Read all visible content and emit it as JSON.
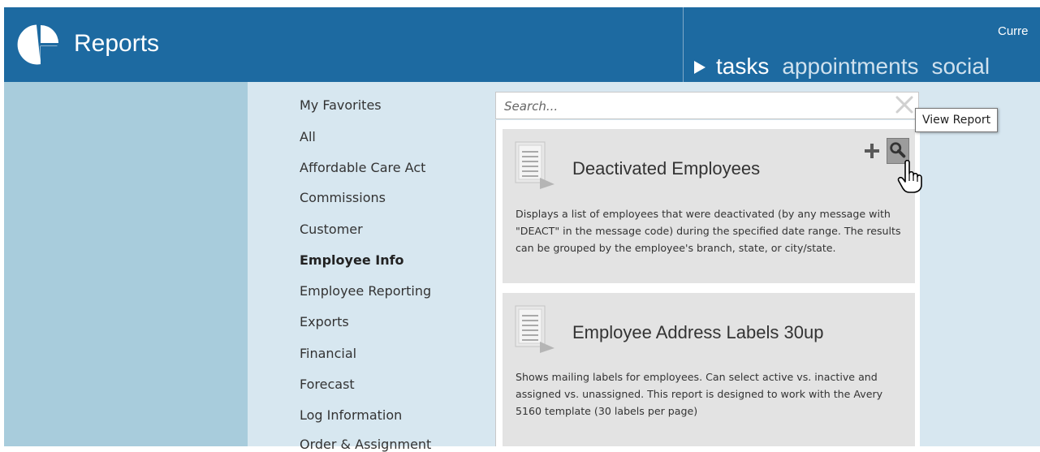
{
  "header": {
    "app_title": "Reports",
    "current_label": "Curre",
    "nav": {
      "arrow": "play-triangle-icon",
      "items": [
        {
          "label": "tasks",
          "active": true
        },
        {
          "label": "appointments",
          "active": false
        },
        {
          "label": "social",
          "active": false
        }
      ]
    },
    "colors": {
      "brand": "#1d6aa1"
    }
  },
  "sidebar": {
    "categories": [
      {
        "label": "My Favorites"
      },
      {
        "label": "All"
      },
      {
        "label": "Affordable Care Act"
      },
      {
        "label": "Commissions"
      },
      {
        "label": "Customer"
      },
      {
        "label": "Employee Info",
        "selected": true
      },
      {
        "label": "Employee Reporting"
      },
      {
        "label": "Exports"
      },
      {
        "label": "Financial"
      },
      {
        "label": "Forecast"
      },
      {
        "label": "Log Information"
      },
      {
        "label": "Order & Assignment"
      }
    ]
  },
  "search": {
    "placeholder": "Search...",
    "value": ""
  },
  "tooltip": {
    "text": "View Report"
  },
  "reports": [
    {
      "title": "Deactivated Employees",
      "description": "Displays a list of employees that were deactivated (by any message with \"DEACT\" in the message code) during the specified date range.  The results can be grouped by the employee's branch, state, or city/state."
    },
    {
      "title": "Employee Address Labels 30up",
      "description": "Shows mailing labels for employees.  Can select active vs. inactive and assigned vs. unassigned. This report is designed to work with the Avery 5160 template (30 labels per page)"
    }
  ]
}
